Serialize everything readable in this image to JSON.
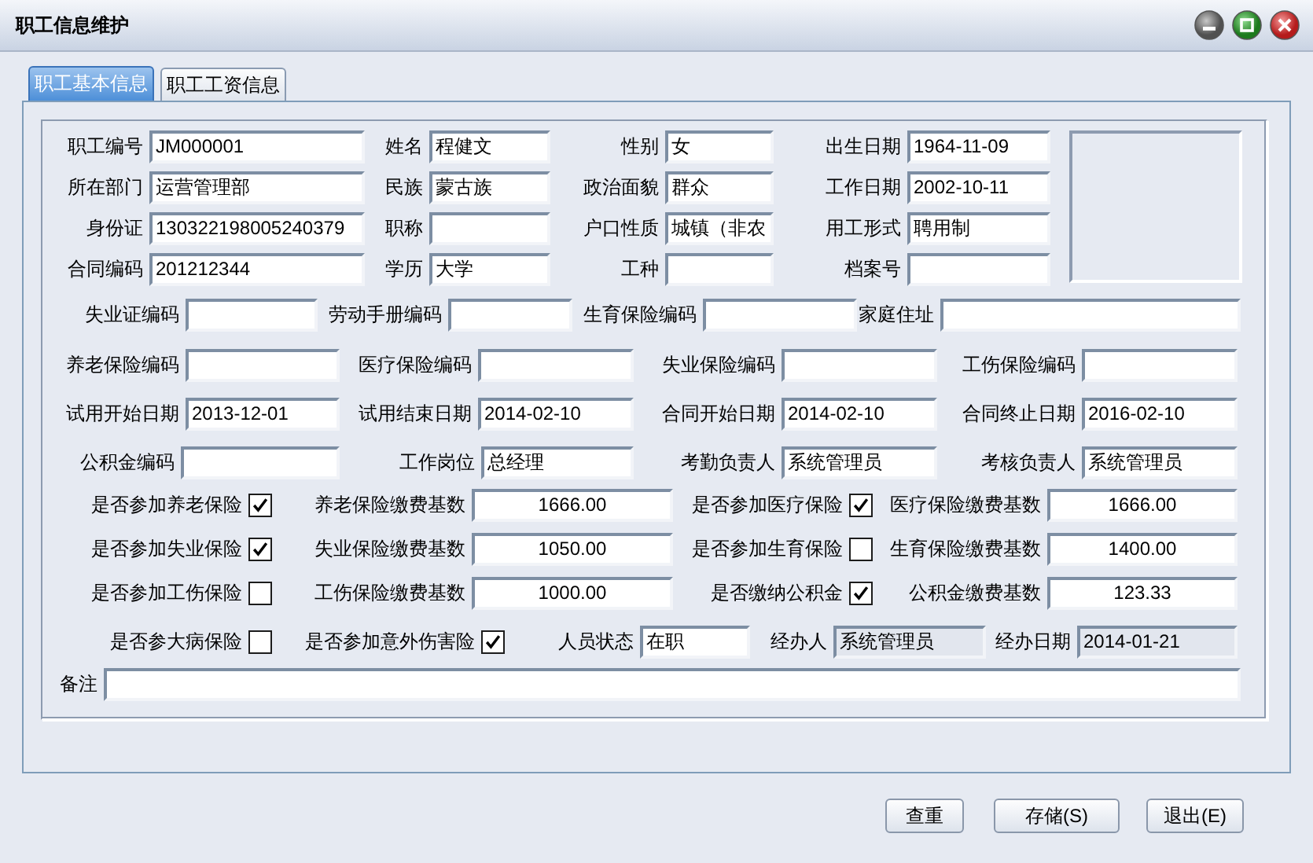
{
  "window": {
    "title": "职工信息维护"
  },
  "tabs": [
    {
      "label": "职工基本信息",
      "selected": true
    },
    {
      "label": "职工工资信息",
      "selected": false
    }
  ],
  "rows": [
    {
      "items": [
        {
          "kind": "text",
          "label": "职工编号",
          "value": "JM000001",
          "disabled": false
        },
        {
          "kind": "text",
          "label": "姓名",
          "value": "程健文",
          "disabled": false
        },
        {
          "kind": "text",
          "label": "性别",
          "value": "女",
          "disabled": false
        },
        {
          "kind": "text",
          "label": "出生日期",
          "value": "1964-11-09",
          "disabled": false
        }
      ]
    },
    {
      "items": [
        {
          "kind": "text",
          "label": "所在部门",
          "value": "运营管理部",
          "disabled": false
        },
        {
          "kind": "text",
          "label": "民族",
          "value": "蒙古族",
          "disabled": false
        },
        {
          "kind": "text",
          "label": "政治面貌",
          "value": "群众",
          "disabled": false
        },
        {
          "kind": "text",
          "label": "工作日期",
          "value": "2002-10-11",
          "disabled": false
        }
      ]
    },
    {
      "items": [
        {
          "kind": "text",
          "label": "身份证",
          "value": "130322198005240379",
          "disabled": false
        },
        {
          "kind": "text",
          "label": "职称",
          "disabled": false
        },
        {
          "kind": "text",
          "label": "户口性质",
          "value": "城镇（非农",
          "disabled": false
        },
        {
          "kind": "text",
          "label": "用工形式",
          "value": "聘用制",
          "disabled": false
        }
      ]
    },
    {
      "items": [
        {
          "kind": "text",
          "label": "合同编码",
          "value": "201212344",
          "disabled": false
        },
        {
          "kind": "text",
          "label": "学历",
          "value": "大学",
          "disabled": false
        },
        {
          "kind": "text",
          "label": "工种",
          "disabled": false
        },
        {
          "kind": "text",
          "label": "档案号",
          "disabled": false
        }
      ]
    },
    {
      "items": [
        {
          "kind": "text",
          "label": "失业证编码",
          "disabled": false
        },
        {
          "kind": "text",
          "label": "劳动手册编码",
          "disabled": false
        },
        {
          "kind": "text",
          "label": "生育保险编码",
          "disabled": false
        },
        {
          "kind": "text",
          "label": "家庭住址",
          "disabled": false
        }
      ]
    },
    {
      "items": [
        {
          "kind": "text",
          "label": "养老保险编码",
          "disabled": false
        },
        {
          "kind": "text",
          "label": "医疗保险编码",
          "disabled": false
        },
        {
          "kind": "text",
          "label": "失业保险编码",
          "disabled": false
        },
        {
          "kind": "text",
          "label": "工伤保险编码",
          "disabled": false
        }
      ]
    },
    {
      "items": [
        {
          "kind": "text",
          "label": "试用开始日期",
          "value": "2013-12-01",
          "disabled": false
        },
        {
          "kind": "text",
          "label": "试用结束日期",
          "value": "2014-02-10",
          "disabled": false
        },
        {
          "kind": "text",
          "label": "合同开始日期",
          "value": "2014-02-10",
          "disabled": false
        },
        {
          "kind": "text",
          "label": "合同终止日期",
          "value": "2016-02-10",
          "disabled": false
        }
      ]
    },
    {
      "items": [
        {
          "kind": "text",
          "label": "公积金编码",
          "disabled": false
        },
        {
          "kind": "text",
          "label": "工作岗位",
          "value": "总经理",
          "disabled": false
        },
        {
          "kind": "text",
          "label": "考勤负责人",
          "value": "系统管理员",
          "disabled": false
        },
        {
          "kind": "text",
          "label": "考核负责人",
          "value": "系统管理员",
          "disabled": false
        }
      ]
    },
    {
      "items": [
        {
          "kind": "check",
          "label": "是否参加养老保险",
          "checked": true
        },
        {
          "kind": "number",
          "label": "养老保险缴费基数",
          "value": "1666.00",
          "disabled": false
        },
        {
          "kind": "check",
          "label": "是否参加医疗保险",
          "checked": true
        },
        {
          "kind": "number",
          "label": "医疗保险缴费基数",
          "value": "1666.00",
          "disabled": false
        }
      ]
    },
    {
      "items": [
        {
          "kind": "check",
          "label": "是否参加失业保险",
          "checked": true
        },
        {
          "kind": "number",
          "label": "失业保险缴费基数",
          "value": "1050.00",
          "disabled": false
        },
        {
          "kind": "check",
          "label": "是否参加生育保险",
          "checked": false
        },
        {
          "kind": "number",
          "label": "生育保险缴费基数",
          "value": "1400.00",
          "disabled": false
        }
      ]
    },
    {
      "items": [
        {
          "kind": "check",
          "label": "是否参加工伤保险",
          "checked": false
        },
        {
          "kind": "number",
          "label": "工伤保险缴费基数",
          "value": "1000.00",
          "disabled": false
        },
        {
          "kind": "check",
          "label": "是否缴纳公积金",
          "checked": true
        },
        {
          "kind": "number",
          "label": "公积金缴费基数",
          "value": "123.33",
          "disabled": false
        }
      ]
    },
    {
      "items": [
        {
          "kind": "check",
          "label": "是否参大病保险",
          "checked": false
        },
        {
          "kind": "check",
          "label": "是否参加意外伤害险",
          "checked": true
        },
        {
          "kind": "text",
          "label": "人员状态",
          "value": "在职",
          "disabled": false
        },
        {
          "kind": "text",
          "label": "经办人",
          "value": "系统管理员",
          "disabled": true
        },
        {
          "kind": "text",
          "label": "经办日期",
          "value": "2014-01-21",
          "disabled": true
        }
      ]
    },
    {
      "items": [
        {
          "kind": "text",
          "label": "备注",
          "disabled": false
        }
      ]
    }
  ],
  "buttons": [
    "查重",
    "存储(S)",
    "退出(E)"
  ]
}
